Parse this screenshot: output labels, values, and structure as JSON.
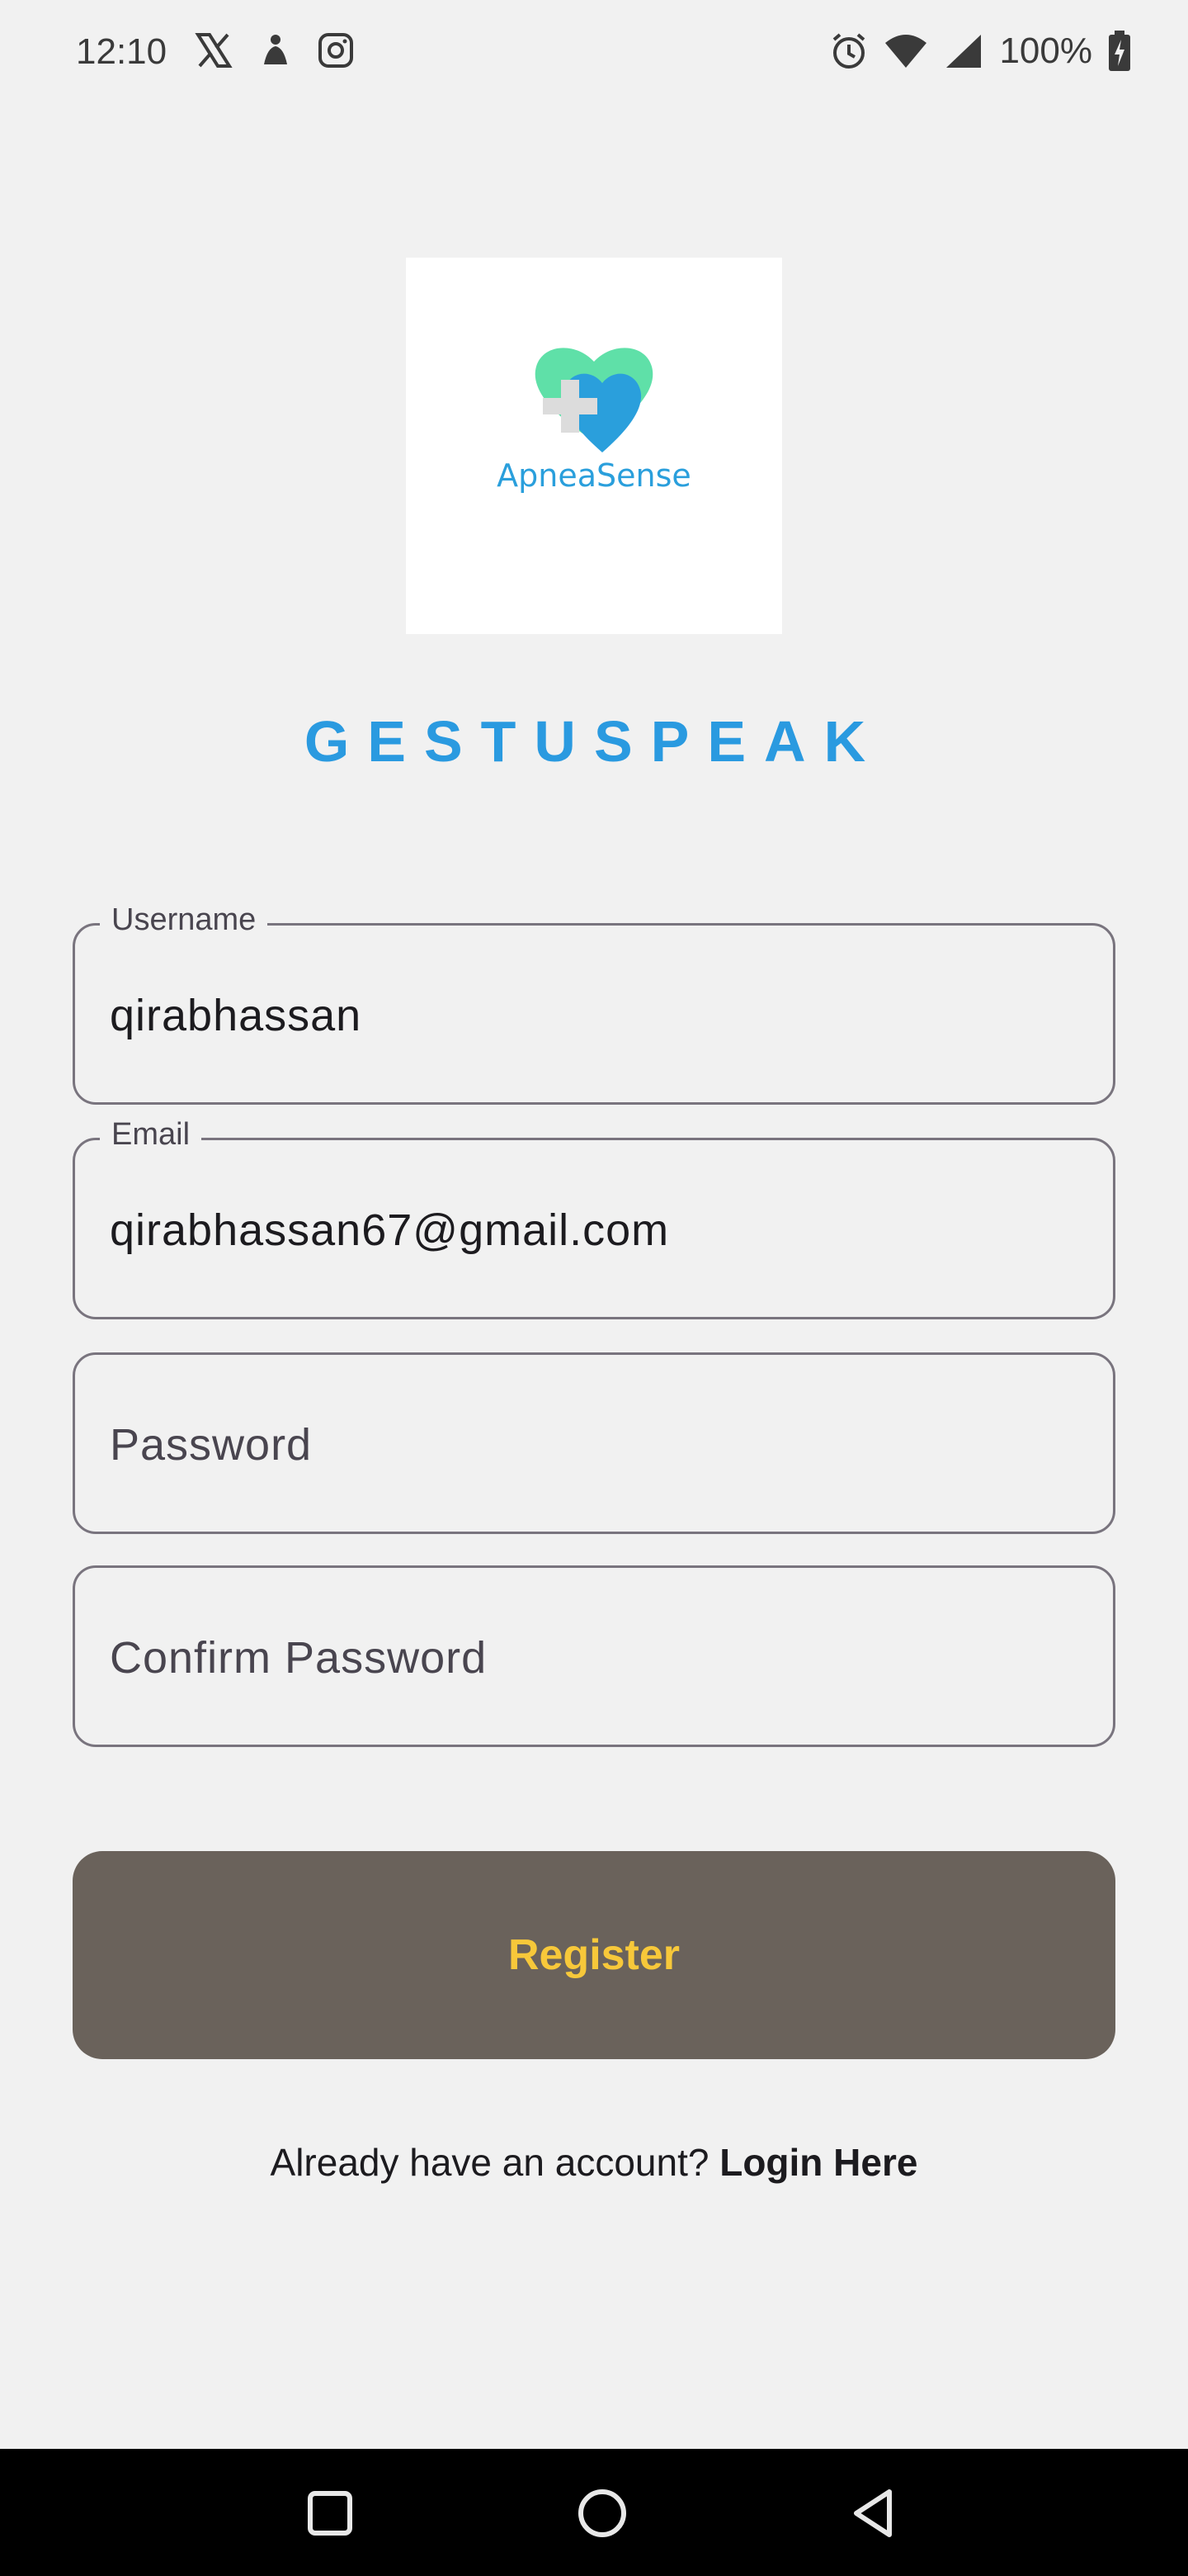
{
  "status_bar": {
    "time": "12:10",
    "left_icons": [
      "x-icon",
      "notification-icon",
      "instagram-icon"
    ],
    "right_icons": [
      "alarm-icon",
      "wifi-icon",
      "signal-icon",
      "battery-icon"
    ],
    "battery": "100%"
  },
  "logo": {
    "text": "ApneaSense",
    "colors": {
      "heart_green": "#5fe0a8",
      "heart_blue": "#2a9fdc",
      "cross": "#dcdcdc"
    }
  },
  "title": "GESTUSPEAK",
  "form": {
    "username": {
      "label": "Username",
      "value": "qirabhassan"
    },
    "email": {
      "label": "Email",
      "value": "qirabhassan67@gmail.com"
    },
    "password": {
      "placeholder": "Password"
    },
    "confirm_password": {
      "placeholder": "Confirm Password"
    }
  },
  "register_button": {
    "label": "Register",
    "bg": "#6a625b",
    "text_color": "#f7c83a"
  },
  "login_prompt": {
    "text": "Already have an account? ",
    "link": "Login Here"
  },
  "nav_bar": {
    "buttons": [
      "recents-icon",
      "home-icon",
      "back-icon"
    ]
  }
}
